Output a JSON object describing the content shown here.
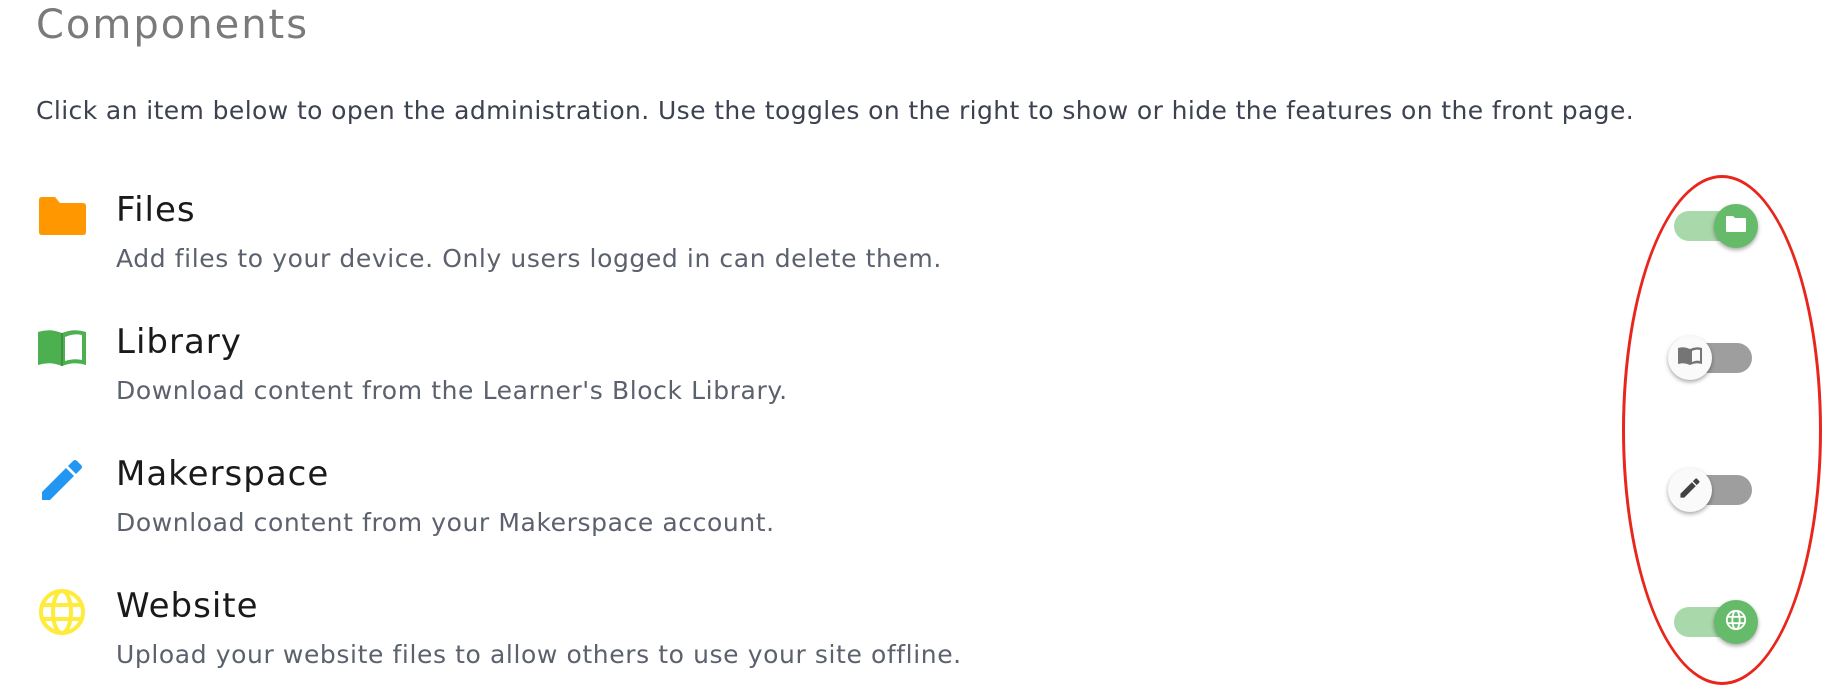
{
  "page": {
    "title": "Components",
    "intro": "Click an item below to open the administration. Use the toggles on the right to show or hide the features on the front page."
  },
  "components": [
    {
      "name": "Files",
      "description": "Add files to your device. Only users logged in can delete them.",
      "icon": "folder-icon",
      "icon_color": "#ff9800",
      "enabled": true
    },
    {
      "name": "Library",
      "description": "Download content from the Learner's Block Library.",
      "icon": "book-icon",
      "icon_color": "#4caf50",
      "enabled": false
    },
    {
      "name": "Makerspace",
      "description": "Download content from your Makerspace account.",
      "icon": "pencil-icon",
      "icon_color": "#2196f3",
      "enabled": false
    },
    {
      "name": "Website",
      "description": "Upload your website files to allow others to use your site offline.",
      "icon": "globe-icon",
      "icon_color": "#ffeb3b",
      "enabled": true
    }
  ],
  "colors": {
    "toggle_on_track": "#a9d8ab",
    "toggle_on_knob": "#66bb6a",
    "toggle_off_track": "#9e9e9e",
    "toggle_off_knob": "#fafafa",
    "highlight": "#e8261c"
  }
}
